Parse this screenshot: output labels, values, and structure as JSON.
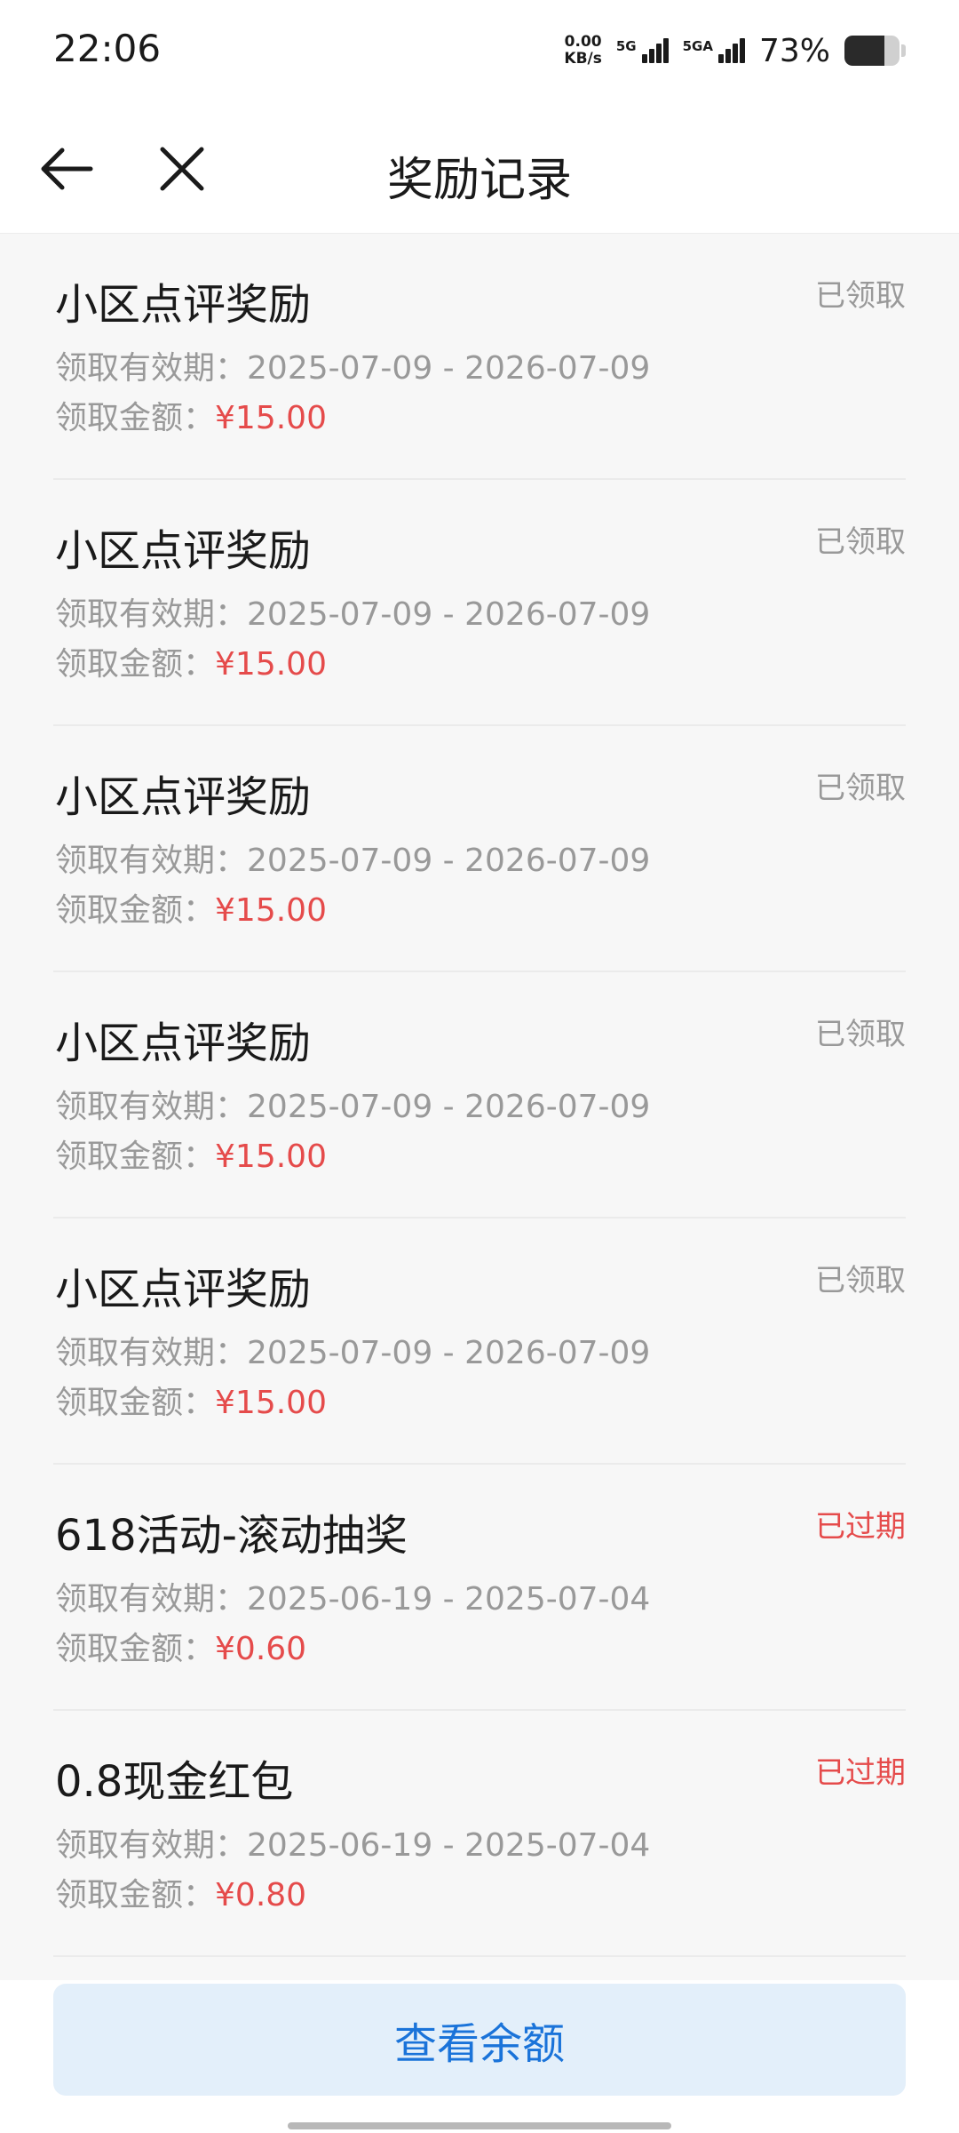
{
  "status_bar": {
    "time": "22:06",
    "net_speed_value": "0.00",
    "net_speed_unit": "KB/s",
    "sim1_label": "5G",
    "sim2_label": "5GA",
    "battery_percent": "73%",
    "battery_level": 0.73
  },
  "nav": {
    "title": "奖励记录",
    "back_icon": "arrow-left-icon",
    "close_icon": "close-icon"
  },
  "records": [
    {
      "title": "小区点评奖励",
      "status": "已领取",
      "expired": false,
      "validity_label": "领取有效期：",
      "validity": "2025-07-09 - 2026-07-09",
      "amount_label": "领取金额：",
      "amount": "¥15.00"
    },
    {
      "title": "小区点评奖励",
      "status": "已领取",
      "expired": false,
      "validity_label": "领取有效期：",
      "validity": "2025-07-09 - 2026-07-09",
      "amount_label": "领取金额：",
      "amount": "¥15.00"
    },
    {
      "title": "小区点评奖励",
      "status": "已领取",
      "expired": false,
      "validity_label": "领取有效期：",
      "validity": "2025-07-09 - 2026-07-09",
      "amount_label": "领取金额：",
      "amount": "¥15.00"
    },
    {
      "title": "小区点评奖励",
      "status": "已领取",
      "expired": false,
      "validity_label": "领取有效期：",
      "validity": "2025-07-09 - 2026-07-09",
      "amount_label": "领取金额：",
      "amount": "¥15.00"
    },
    {
      "title": "小区点评奖励",
      "status": "已领取",
      "expired": false,
      "validity_label": "领取有效期：",
      "validity": "2025-07-09 - 2026-07-09",
      "amount_label": "领取金额：",
      "amount": "¥15.00"
    },
    {
      "title": "618活动-滚动抽奖",
      "status": "已过期",
      "expired": true,
      "validity_label": "领取有效期：",
      "validity": "2025-06-19 - 2025-07-04",
      "amount_label": "领取金额：",
      "amount": "¥0.60"
    },
    {
      "title": "0.8现金红包",
      "status": "已过期",
      "expired": true,
      "validity_label": "领取有效期：",
      "validity": "2025-06-19 - 2025-07-04",
      "amount_label": "领取金额：",
      "amount": "¥0.80"
    }
  ],
  "footer": {
    "balance_button_label": "查看余额"
  },
  "colors": {
    "accent_red": "#e54b4b",
    "button_bg": "#e3effa",
    "button_text": "#1a73d9",
    "muted_text": "#999999"
  }
}
